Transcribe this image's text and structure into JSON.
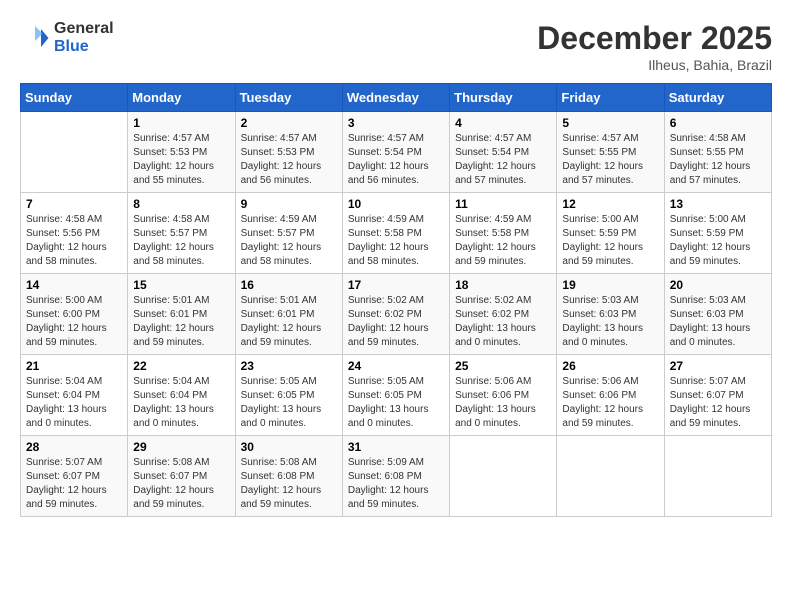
{
  "header": {
    "logo_general": "General",
    "logo_blue": "Blue",
    "month_title": "December 2025",
    "location": "Ilheus, Bahia, Brazil"
  },
  "weekdays": [
    "Sunday",
    "Monday",
    "Tuesday",
    "Wednesday",
    "Thursday",
    "Friday",
    "Saturday"
  ],
  "weeks": [
    [
      {
        "day": "",
        "info": ""
      },
      {
        "day": "1",
        "info": "Sunrise: 4:57 AM\nSunset: 5:53 PM\nDaylight: 12 hours\nand 55 minutes."
      },
      {
        "day": "2",
        "info": "Sunrise: 4:57 AM\nSunset: 5:53 PM\nDaylight: 12 hours\nand 56 minutes."
      },
      {
        "day": "3",
        "info": "Sunrise: 4:57 AM\nSunset: 5:54 PM\nDaylight: 12 hours\nand 56 minutes."
      },
      {
        "day": "4",
        "info": "Sunrise: 4:57 AM\nSunset: 5:54 PM\nDaylight: 12 hours\nand 57 minutes."
      },
      {
        "day": "5",
        "info": "Sunrise: 4:57 AM\nSunset: 5:55 PM\nDaylight: 12 hours\nand 57 minutes."
      },
      {
        "day": "6",
        "info": "Sunrise: 4:58 AM\nSunset: 5:55 PM\nDaylight: 12 hours\nand 57 minutes."
      }
    ],
    [
      {
        "day": "7",
        "info": "Sunrise: 4:58 AM\nSunset: 5:56 PM\nDaylight: 12 hours\nand 58 minutes."
      },
      {
        "day": "8",
        "info": "Sunrise: 4:58 AM\nSunset: 5:57 PM\nDaylight: 12 hours\nand 58 minutes."
      },
      {
        "day": "9",
        "info": "Sunrise: 4:59 AM\nSunset: 5:57 PM\nDaylight: 12 hours\nand 58 minutes."
      },
      {
        "day": "10",
        "info": "Sunrise: 4:59 AM\nSunset: 5:58 PM\nDaylight: 12 hours\nand 58 minutes."
      },
      {
        "day": "11",
        "info": "Sunrise: 4:59 AM\nSunset: 5:58 PM\nDaylight: 12 hours\nand 59 minutes."
      },
      {
        "day": "12",
        "info": "Sunrise: 5:00 AM\nSunset: 5:59 PM\nDaylight: 12 hours\nand 59 minutes."
      },
      {
        "day": "13",
        "info": "Sunrise: 5:00 AM\nSunset: 5:59 PM\nDaylight: 12 hours\nand 59 minutes."
      }
    ],
    [
      {
        "day": "14",
        "info": "Sunrise: 5:00 AM\nSunset: 6:00 PM\nDaylight: 12 hours\nand 59 minutes."
      },
      {
        "day": "15",
        "info": "Sunrise: 5:01 AM\nSunset: 6:01 PM\nDaylight: 12 hours\nand 59 minutes."
      },
      {
        "day": "16",
        "info": "Sunrise: 5:01 AM\nSunset: 6:01 PM\nDaylight: 12 hours\nand 59 minutes."
      },
      {
        "day": "17",
        "info": "Sunrise: 5:02 AM\nSunset: 6:02 PM\nDaylight: 12 hours\nand 59 minutes."
      },
      {
        "day": "18",
        "info": "Sunrise: 5:02 AM\nSunset: 6:02 PM\nDaylight: 13 hours\nand 0 minutes."
      },
      {
        "day": "19",
        "info": "Sunrise: 5:03 AM\nSunset: 6:03 PM\nDaylight: 13 hours\nand 0 minutes."
      },
      {
        "day": "20",
        "info": "Sunrise: 5:03 AM\nSunset: 6:03 PM\nDaylight: 13 hours\nand 0 minutes."
      }
    ],
    [
      {
        "day": "21",
        "info": "Sunrise: 5:04 AM\nSunset: 6:04 PM\nDaylight: 13 hours\nand 0 minutes."
      },
      {
        "day": "22",
        "info": "Sunrise: 5:04 AM\nSunset: 6:04 PM\nDaylight: 13 hours\nand 0 minutes."
      },
      {
        "day": "23",
        "info": "Sunrise: 5:05 AM\nSunset: 6:05 PM\nDaylight: 13 hours\nand 0 minutes."
      },
      {
        "day": "24",
        "info": "Sunrise: 5:05 AM\nSunset: 6:05 PM\nDaylight: 13 hours\nand 0 minutes."
      },
      {
        "day": "25",
        "info": "Sunrise: 5:06 AM\nSunset: 6:06 PM\nDaylight: 13 hours\nand 0 minutes."
      },
      {
        "day": "26",
        "info": "Sunrise: 5:06 AM\nSunset: 6:06 PM\nDaylight: 12 hours\nand 59 minutes."
      },
      {
        "day": "27",
        "info": "Sunrise: 5:07 AM\nSunset: 6:07 PM\nDaylight: 12 hours\nand 59 minutes."
      }
    ],
    [
      {
        "day": "28",
        "info": "Sunrise: 5:07 AM\nSunset: 6:07 PM\nDaylight: 12 hours\nand 59 minutes."
      },
      {
        "day": "29",
        "info": "Sunrise: 5:08 AM\nSunset: 6:07 PM\nDaylight: 12 hours\nand 59 minutes."
      },
      {
        "day": "30",
        "info": "Sunrise: 5:08 AM\nSunset: 6:08 PM\nDaylight: 12 hours\nand 59 minutes."
      },
      {
        "day": "31",
        "info": "Sunrise: 5:09 AM\nSunset: 6:08 PM\nDaylight: 12 hours\nand 59 minutes."
      },
      {
        "day": "",
        "info": ""
      },
      {
        "day": "",
        "info": ""
      },
      {
        "day": "",
        "info": ""
      }
    ]
  ]
}
